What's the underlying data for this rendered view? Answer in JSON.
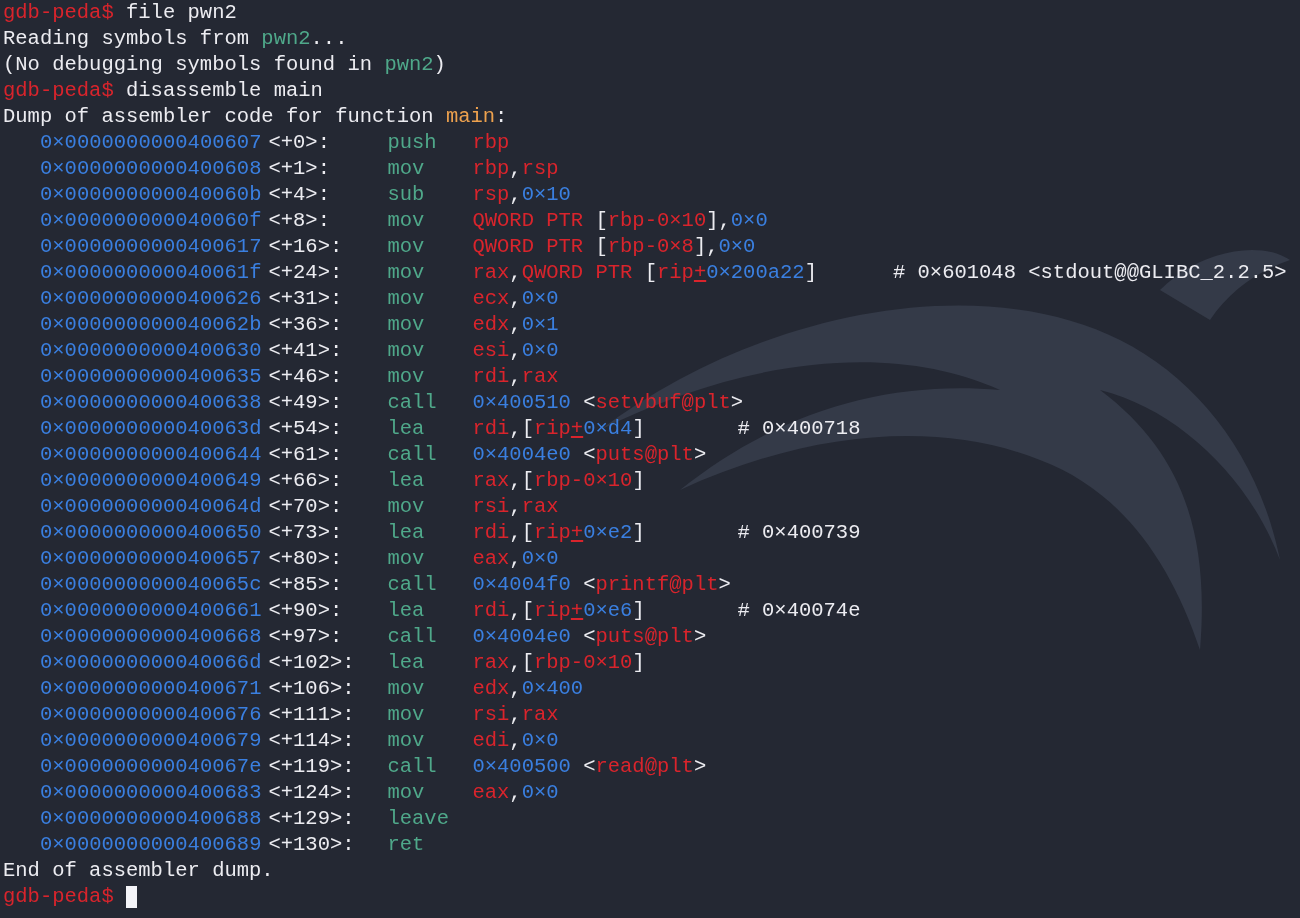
{
  "terminal": {
    "lines": [
      {
        "kind": "prompt",
        "prompt": "gdb-peda$",
        "command": "file pwn2"
      },
      {
        "kind": "output",
        "segments": [
          {
            "kind": "plain",
            "text": "Reading symbols from "
          },
          {
            "kind": "file",
            "text": "pwn2"
          },
          {
            "kind": "plain",
            "text": "..."
          }
        ]
      },
      {
        "kind": "output",
        "segments": [
          {
            "kind": "plain",
            "text": "(No debugging symbols found in "
          },
          {
            "kind": "file",
            "text": "pwn2"
          },
          {
            "kind": "plain",
            "text": ")"
          }
        ]
      },
      {
        "kind": "prompt",
        "prompt": "gdb-peda$",
        "command": "disassemble main"
      },
      {
        "kind": "output",
        "segments": [
          {
            "kind": "plain",
            "text": "Dump of assembler code for function "
          },
          {
            "kind": "keyword",
            "text": "main"
          },
          {
            "kind": "plain",
            "text": ":"
          }
        ]
      },
      {
        "kind": "asm",
        "address": "0×0000000000400607",
        "offset": "<+0>:",
        "mnemonic": "push",
        "operands": [
          {
            "kind": "reg",
            "text": "rbp"
          }
        ]
      },
      {
        "kind": "asm",
        "address": "0×0000000000400608",
        "offset": "<+1>:",
        "mnemonic": "mov",
        "operands": [
          {
            "kind": "reg",
            "text": "rbp"
          },
          {
            "kind": "punct",
            "text": ","
          },
          {
            "kind": "reg",
            "text": "rsp"
          }
        ]
      },
      {
        "kind": "asm",
        "address": "0×000000000040060b",
        "offset": "<+4>:",
        "mnemonic": "sub",
        "operands": [
          {
            "kind": "reg",
            "text": "rsp"
          },
          {
            "kind": "punct",
            "text": ","
          },
          {
            "kind": "num",
            "text": "0×10"
          }
        ]
      },
      {
        "kind": "asm",
        "address": "0×000000000040060f",
        "offset": "<+8>:",
        "mnemonic": "mov",
        "operands": [
          {
            "kind": "reg",
            "text": "QWORD PTR"
          },
          {
            "kind": "punct",
            "text": " ["
          },
          {
            "kind": "reg",
            "text": "rbp-0×10"
          },
          {
            "kind": "punct",
            "text": "],"
          },
          {
            "kind": "num",
            "text": "0×0"
          }
        ]
      },
      {
        "kind": "asm",
        "address": "0×0000000000400617",
        "offset": "<+16>:",
        "mnemonic": "mov",
        "operands": [
          {
            "kind": "reg",
            "text": "QWORD PTR"
          },
          {
            "kind": "punct",
            "text": " ["
          },
          {
            "kind": "reg",
            "text": "rbp-0×8"
          },
          {
            "kind": "punct",
            "text": "],"
          },
          {
            "kind": "num",
            "text": "0×0"
          }
        ]
      },
      {
        "kind": "asm",
        "address": "0×000000000040061f",
        "offset": "<+24>:",
        "mnemonic": "mov",
        "operands": [
          {
            "kind": "reg",
            "text": "rax"
          },
          {
            "kind": "punct",
            "text": ","
          },
          {
            "kind": "reg",
            "text": "QWORD PTR"
          },
          {
            "kind": "punct",
            "text": " ["
          },
          {
            "kind": "reg",
            "text": "rip"
          },
          {
            "kind": "op",
            "text": "+"
          },
          {
            "kind": "num",
            "text": "0×200a22"
          },
          {
            "kind": "punct",
            "text": "]"
          }
        ],
        "comment": "# 0×601048 <stdout@@GLIBC_2.2.5>"
      },
      {
        "kind": "asm",
        "address": "0×0000000000400626",
        "offset": "<+31>:",
        "mnemonic": "mov",
        "operands": [
          {
            "kind": "reg",
            "text": "ecx"
          },
          {
            "kind": "punct",
            "text": ","
          },
          {
            "kind": "num",
            "text": "0×0"
          }
        ]
      },
      {
        "kind": "asm",
        "address": "0×000000000040062b",
        "offset": "<+36>:",
        "mnemonic": "mov",
        "operands": [
          {
            "kind": "reg",
            "text": "edx"
          },
          {
            "kind": "punct",
            "text": ","
          },
          {
            "kind": "num",
            "text": "0×1"
          }
        ]
      },
      {
        "kind": "asm",
        "address": "0×0000000000400630",
        "offset": "<+41>:",
        "mnemonic": "mov",
        "operands": [
          {
            "kind": "reg",
            "text": "esi"
          },
          {
            "kind": "punct",
            "text": ","
          },
          {
            "kind": "num",
            "text": "0×0"
          }
        ]
      },
      {
        "kind": "asm",
        "address": "0×0000000000400635",
        "offset": "<+46>:",
        "mnemonic": "mov",
        "operands": [
          {
            "kind": "reg",
            "text": "rdi"
          },
          {
            "kind": "punct",
            "text": ","
          },
          {
            "kind": "reg",
            "text": "rax"
          }
        ]
      },
      {
        "kind": "asm",
        "address": "0×0000000000400638",
        "offset": "<+49>:",
        "mnemonic": "call",
        "operands": [
          {
            "kind": "num",
            "text": "0×400510"
          },
          {
            "kind": "punct",
            "text": " <"
          },
          {
            "kind": "reg",
            "text": "setvbuf@plt"
          },
          {
            "kind": "punct",
            "text": ">"
          }
        ]
      },
      {
        "kind": "asm",
        "address": "0×000000000040063d",
        "offset": "<+54>:",
        "mnemonic": "lea",
        "operands": [
          {
            "kind": "reg",
            "text": "rdi"
          },
          {
            "kind": "punct",
            "text": ",["
          },
          {
            "kind": "reg",
            "text": "rip"
          },
          {
            "kind": "op",
            "text": "+"
          },
          {
            "kind": "num",
            "text": "0×d4"
          },
          {
            "kind": "punct",
            "text": "]"
          }
        ],
        "comment": "# 0×400718"
      },
      {
        "kind": "asm",
        "address": "0×0000000000400644",
        "offset": "<+61>:",
        "mnemonic": "call",
        "operands": [
          {
            "kind": "num",
            "text": "0×4004e0"
          },
          {
            "kind": "punct",
            "text": " <"
          },
          {
            "kind": "reg",
            "text": "puts@plt"
          },
          {
            "kind": "punct",
            "text": ">"
          }
        ]
      },
      {
        "kind": "asm",
        "address": "0×0000000000400649",
        "offset": "<+66>:",
        "mnemonic": "lea",
        "operands": [
          {
            "kind": "reg",
            "text": "rax"
          },
          {
            "kind": "punct",
            "text": ",["
          },
          {
            "kind": "reg",
            "text": "rbp-0×10"
          },
          {
            "kind": "punct",
            "text": "]"
          }
        ]
      },
      {
        "kind": "asm",
        "address": "0×000000000040064d",
        "offset": "<+70>:",
        "mnemonic": "mov",
        "operands": [
          {
            "kind": "reg",
            "text": "rsi"
          },
          {
            "kind": "punct",
            "text": ","
          },
          {
            "kind": "reg",
            "text": "rax"
          }
        ]
      },
      {
        "kind": "asm",
        "address": "0×0000000000400650",
        "offset": "<+73>:",
        "mnemonic": "lea",
        "operands": [
          {
            "kind": "reg",
            "text": "rdi"
          },
          {
            "kind": "punct",
            "text": ",["
          },
          {
            "kind": "reg",
            "text": "rip"
          },
          {
            "kind": "op",
            "text": "+"
          },
          {
            "kind": "num",
            "text": "0×e2"
          },
          {
            "kind": "punct",
            "text": "]"
          }
        ],
        "comment": "# 0×400739"
      },
      {
        "kind": "asm",
        "address": "0×0000000000400657",
        "offset": "<+80>:",
        "mnemonic": "mov",
        "operands": [
          {
            "kind": "reg",
            "text": "eax"
          },
          {
            "kind": "punct",
            "text": ","
          },
          {
            "kind": "num",
            "text": "0×0"
          }
        ]
      },
      {
        "kind": "asm",
        "address": "0×000000000040065c",
        "offset": "<+85>:",
        "mnemonic": "call",
        "operands": [
          {
            "kind": "num",
            "text": "0×4004f0"
          },
          {
            "kind": "punct",
            "text": " <"
          },
          {
            "kind": "reg",
            "text": "printf@plt"
          },
          {
            "kind": "punct",
            "text": ">"
          }
        ]
      },
      {
        "kind": "asm",
        "address": "0×0000000000400661",
        "offset": "<+90>:",
        "mnemonic": "lea",
        "operands": [
          {
            "kind": "reg",
            "text": "rdi"
          },
          {
            "kind": "punct",
            "text": ",["
          },
          {
            "kind": "reg",
            "text": "rip"
          },
          {
            "kind": "op",
            "text": "+"
          },
          {
            "kind": "num",
            "text": "0×e6"
          },
          {
            "kind": "punct",
            "text": "]"
          }
        ],
        "comment": "# 0×40074e"
      },
      {
        "kind": "asm",
        "address": "0×0000000000400668",
        "offset": "<+97>:",
        "mnemonic": "call",
        "operands": [
          {
            "kind": "num",
            "text": "0×4004e0"
          },
          {
            "kind": "punct",
            "text": " <"
          },
          {
            "kind": "reg",
            "text": "puts@plt"
          },
          {
            "kind": "punct",
            "text": ">"
          }
        ]
      },
      {
        "kind": "asm",
        "address": "0×000000000040066d",
        "offset": "<+102>:",
        "mnemonic": "lea",
        "operands": [
          {
            "kind": "reg",
            "text": "rax"
          },
          {
            "kind": "punct",
            "text": ",["
          },
          {
            "kind": "reg",
            "text": "rbp-0×10"
          },
          {
            "kind": "punct",
            "text": "]"
          }
        ]
      },
      {
        "kind": "asm",
        "address": "0×0000000000400671",
        "offset": "<+106>:",
        "mnemonic": "mov",
        "operands": [
          {
            "kind": "reg",
            "text": "edx"
          },
          {
            "kind": "punct",
            "text": ","
          },
          {
            "kind": "num",
            "text": "0×400"
          }
        ]
      },
      {
        "kind": "asm",
        "address": "0×0000000000400676",
        "offset": "<+111>:",
        "mnemonic": "mov",
        "operands": [
          {
            "kind": "reg",
            "text": "rsi"
          },
          {
            "kind": "punct",
            "text": ","
          },
          {
            "kind": "reg",
            "text": "rax"
          }
        ]
      },
      {
        "kind": "asm",
        "address": "0×0000000000400679",
        "offset": "<+114>:",
        "mnemonic": "mov",
        "operands": [
          {
            "kind": "reg",
            "text": "edi"
          },
          {
            "kind": "punct",
            "text": ","
          },
          {
            "kind": "num",
            "text": "0×0"
          }
        ]
      },
      {
        "kind": "asm",
        "address": "0×000000000040067e",
        "offset": "<+119>:",
        "mnemonic": "call",
        "operands": [
          {
            "kind": "num",
            "text": "0×400500"
          },
          {
            "kind": "punct",
            "text": " <"
          },
          {
            "kind": "reg",
            "text": "read@plt"
          },
          {
            "kind": "punct",
            "text": ">"
          }
        ]
      },
      {
        "kind": "asm",
        "address": "0×0000000000400683",
        "offset": "<+124>:",
        "mnemonic": "mov",
        "operands": [
          {
            "kind": "reg",
            "text": "eax"
          },
          {
            "kind": "punct",
            "text": ","
          },
          {
            "kind": "num",
            "text": "0×0"
          }
        ]
      },
      {
        "kind": "asm",
        "address": "0×0000000000400688",
        "offset": "<+129>:",
        "mnemonic": "leave"
      },
      {
        "kind": "asm",
        "address": "0×0000000000400689",
        "offset": "<+130>:",
        "mnemonic": "ret"
      },
      {
        "kind": "output",
        "segments": [
          {
            "kind": "plain",
            "text": "End of assembler dump."
          }
        ]
      },
      {
        "kind": "prompt",
        "prompt": "gdb-peda$",
        "cursor": true
      }
    ]
  }
}
